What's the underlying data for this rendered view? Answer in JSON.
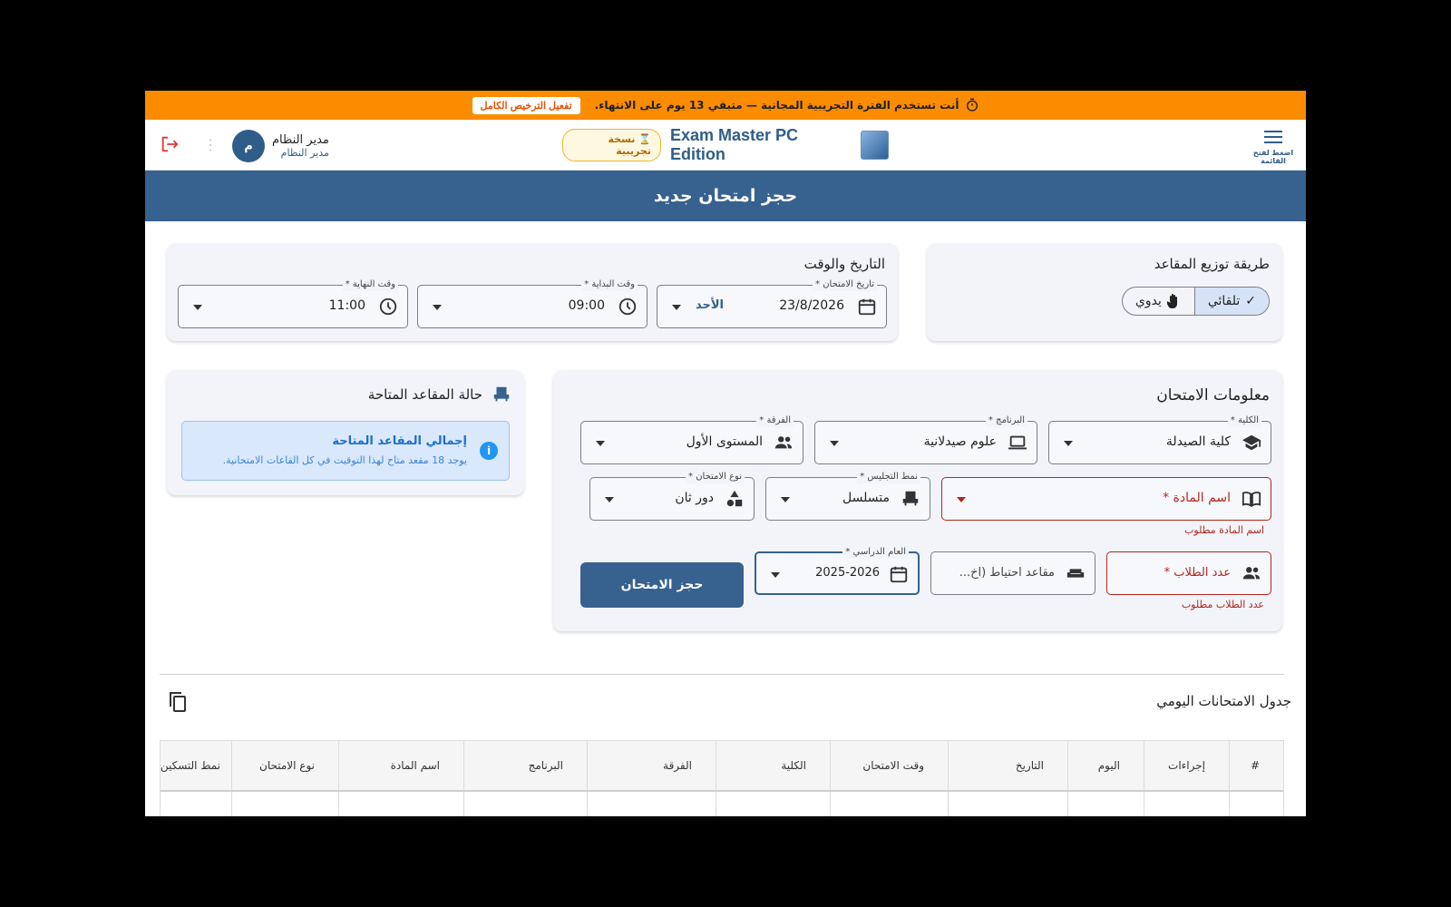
{
  "banner": {
    "message": "أنت تستخدم الفترة التجريبية المجانية — متبقي 13 يوم على الانتهاء.",
    "activate_label": "تفعيل الترخيص الكامل",
    "color": "#fb8c00"
  },
  "appbar": {
    "menu_label": "اضغط لفتح القائمة",
    "app_title": "Exam Master PC Edition",
    "trial_badge": "نسخة تجريبية",
    "user_name": "مدير النظام",
    "user_role": "مدير النظام",
    "avatar_initial": "م"
  },
  "page": {
    "title": "حجز امتحان جديد",
    "accent": "#37618f"
  },
  "seating": {
    "title": "طريقة توزيع المقاعد",
    "options": [
      {
        "label": "تلقائي",
        "selected": true,
        "icon": "check-icon"
      },
      {
        "label": "يدوي",
        "selected": false,
        "icon": "hand-icon"
      }
    ]
  },
  "datetime": {
    "title": "التاريخ والوقت",
    "date": {
      "label": "تاريخ الامتحان *",
      "value": "23/8/2026",
      "day": "الأحد"
    },
    "start": {
      "label": "وقت البداية *",
      "value": "09:00"
    },
    "end": {
      "label": "وقت النهاية *",
      "value": "11:00"
    }
  },
  "exam_info": {
    "title": "معلومات الامتحان",
    "college": {
      "label": "الكلية *",
      "value": "كلية الصيدلة"
    },
    "program": {
      "label": "البرنامج *",
      "value": "علوم صيدلانية"
    },
    "level": {
      "label": "الفرقة *",
      "value": "المستوى الأول"
    },
    "subject": {
      "placeholder": "اسم المادة *",
      "error": "اسم المادة مطلوب"
    },
    "seating_pattern": {
      "label": "نمط التجليس *",
      "value": "متسلسل"
    },
    "exam_type": {
      "label": "نوع الامتحان *",
      "value": "دور ثان"
    },
    "students": {
      "placeholder": "عدد الطلاب *",
      "error": "عدد الطلاب مطلوب"
    },
    "reserve": {
      "placeholder": "مقاعد احتياط (اخ..."
    },
    "academic_year": {
      "label": "العام الدراسي *",
      "value": "2025-2026"
    },
    "submit_label": "حجز الامتحان"
  },
  "availability": {
    "title": "حالة المقاعد المتاحة",
    "box_title": "إجمالي المقاعد المتاحة",
    "box_text": "يوجد 18 مقعد متاح لهذا التوقيت في كل القاعات الامتحانية."
  },
  "schedule": {
    "title": "جدول الامتحانات اليومي",
    "columns": [
      "#",
      "إجراءات",
      "اليوم",
      "التاريخ",
      "وقت الامتحان",
      "الكلية",
      "الفرقة",
      "البرنامج",
      "اسم المادة",
      "نوع الامتحان",
      "نمط التسكين"
    ]
  }
}
